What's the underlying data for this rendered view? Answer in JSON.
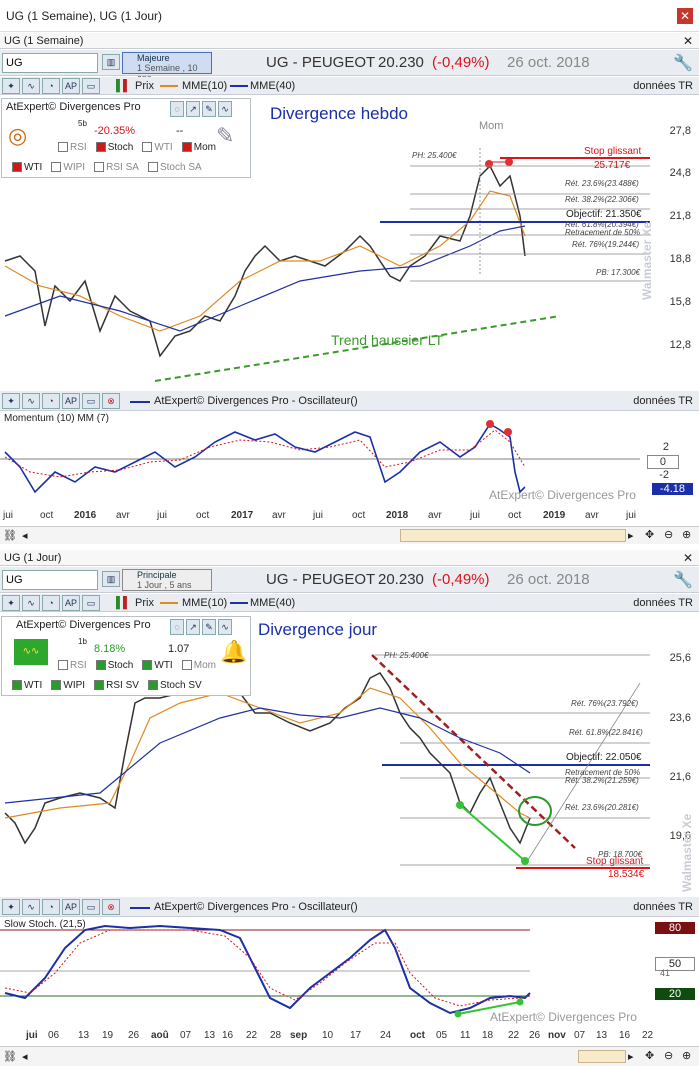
{
  "window": {
    "title": "UG (1 Semaine), UG (1 Jour)"
  },
  "weekly": {
    "pane_title": "UG (1 Semaine)",
    "symbol_input": "UG",
    "timeframe_line1": "Majeure",
    "timeframe_line2": "1 Semaine , 10 ans",
    "header_name": "UG - PEUGEOT",
    "header_price": "20.230",
    "header_change": "(-0,49%)",
    "header_date": "26 oct. 2018",
    "legend_prix": "Prix",
    "legend_mme10": "MME(10)",
    "legend_mme40": "MME(40)",
    "data_source": "données TR",
    "expert": {
      "title": "AtExpert© Divergences Pro",
      "pct": "-20.35%",
      "rr": "--",
      "flags": [
        "RSI",
        "Stoch",
        "WTI",
        "Mom"
      ],
      "flags2": [
        "WTI",
        "WIPI",
        "RSI SA",
        "Stoch SA"
      ],
      "sb": "5b"
    },
    "annotation_title": "Divergence hebdo",
    "annotation_trend": "Trend haussier LT",
    "annotation_mom": "Mom",
    "levels": {
      "ph": "PH: 25.400€",
      "stop": "Stop glissant",
      "stop_val": "25.717€",
      "r236": "Rét. 23.6%(23.488€)",
      "r382": "Rét. 38.2%(22.306€)",
      "objectif": "Objectif: 21.350€",
      "r618": "Rét. 61.8%(20.394€)",
      "r50": "Retracement de 50%",
      "r76": "Rét. 76%(19.244€)",
      "pb": "PB: 17.300€"
    },
    "y_ticks": [
      "27,8",
      "24,8",
      "21,8",
      "18,8",
      "15,8",
      "12,8"
    ],
    "watermark": "Walmaster Xe",
    "osc_title": "AtExpert© Divergences Pro - Oscillateur()",
    "osc_label": "Momentum (10) MM (7)",
    "osc_ticks": [
      "2",
      "0",
      "-2"
    ],
    "osc_value": "-4.18",
    "osc_watermark": "AtExpert© Divergences Pro",
    "x_ticks": [
      "jui",
      "oct",
      "2016",
      "avr",
      "jui",
      "oct",
      "2017",
      "avr",
      "jui",
      "oct",
      "2018",
      "avr",
      "jui",
      "oct",
      "2019",
      "avr",
      "jui"
    ]
  },
  "daily": {
    "pane_title": "UG (1 Jour)",
    "symbol_input": "UG",
    "timeframe_line1": "Principale",
    "timeframe_line2": "1 Jour , 5 ans",
    "header_name": "UG - PEUGEOT",
    "header_price": "20.230",
    "header_change": "(-0,49%)",
    "header_date": "26 oct. 2018",
    "legend_prix": "Prix",
    "legend_mme10": "MME(10)",
    "legend_mme40": "MME(40)",
    "data_source": "données TR",
    "expert": {
      "title": "AtExpert© Divergences Pro",
      "pct": "8.18%",
      "rr": "1.07",
      "flags": [
        "RSI",
        "Stoch",
        "WTI",
        "Mom"
      ],
      "flags2": [
        "WTI",
        "WIPI",
        "RSI SV",
        "Stoch SV"
      ],
      "sb": "1b"
    },
    "annotation_title": "Divergence jour",
    "levels": {
      "ph": "PH: 25.400€",
      "r76": "Rét. 76%(23.792€)",
      "r618": "Rét. 61.8%(22.841€)",
      "objectif": "Objectif: 22.050€",
      "r50": "Retracement de 50%",
      "r382": "Rét. 38.2%(21.259€)",
      "r236": "Rét. 23.6%(20.281€)",
      "pb": "PB: 18.700€",
      "stop": "Stop glissant",
      "stop_val": "18.534€"
    },
    "y_ticks": [
      "25,6",
      "23,6",
      "21,6",
      "19,6"
    ],
    "watermark": "Walmaster Xe",
    "osc_title": "AtExpert© Divergences Pro - Oscillateur()",
    "osc_label": "Slow Stoch. (21,5)",
    "osc_ticks": [
      "80",
      "50",
      "41",
      "20"
    ],
    "osc_watermark": "AtExpert© Divergences Pro",
    "x_ticks": [
      "jui",
      "06",
      "13",
      "19",
      "26",
      "aoû",
      "07",
      "13",
      "16",
      "22",
      "28",
      "sep",
      "10",
      "17",
      "24",
      "oct",
      "05",
      "11",
      "18",
      "22",
      "26",
      "nov",
      "07",
      "13",
      "16",
      "22"
    ]
  }
}
